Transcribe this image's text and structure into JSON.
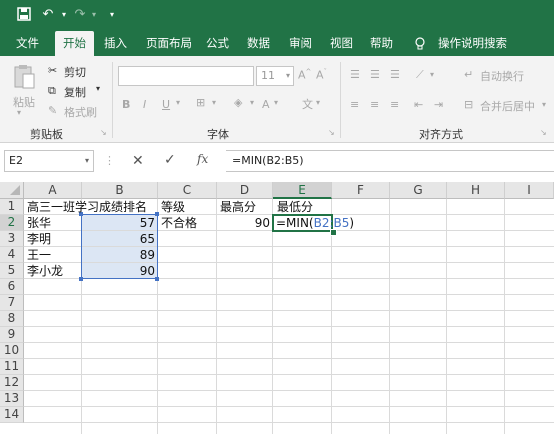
{
  "menu": {
    "items": [
      "文件",
      "开始",
      "插入",
      "页面布局",
      "公式",
      "数据",
      "审阅",
      "视图",
      "帮助"
    ],
    "tell_me": "操作说明搜索"
  },
  "ribbon": {
    "clipboard": {
      "paste": "粘贴",
      "cut": "剪切",
      "copy": "复制",
      "format_painter": "格式刷",
      "label": "剪贴板"
    },
    "font": {
      "size": "11",
      "label": "字体"
    },
    "alignment": {
      "wrap": "自动换行",
      "merge": "合并后居中",
      "label": "对齐方式"
    }
  },
  "formula_bar": {
    "name_box": "E2",
    "formula": "=MIN(B2:B5)"
  },
  "columns": [
    "A",
    "B",
    "C",
    "D",
    "E",
    "F",
    "G",
    "H",
    "I"
  ],
  "rows": [
    "1",
    "2",
    "3",
    "4",
    "5",
    "6",
    "7",
    "8",
    "9",
    "10",
    "11",
    "12",
    "13",
    "14"
  ],
  "cells": {
    "A1": "高三一班学习成绩排名",
    "C1": "等级",
    "D1": "最高分",
    "E1": "最低分",
    "A2": "张华",
    "B2": "57",
    "C2": "不合格",
    "D2": "90",
    "E2_prefix": "=MIN(",
    "E2_ref": "B2:B5",
    "E2_suffix": ")",
    "A3": "李明",
    "B3": "65",
    "A4": "王一",
    "B4": "89",
    "A5": "李小龙",
    "B5": "90"
  },
  "colors": {
    "brand": "#217346",
    "range_highlight": "#dce6f4",
    "range_border": "#4472c4"
  }
}
